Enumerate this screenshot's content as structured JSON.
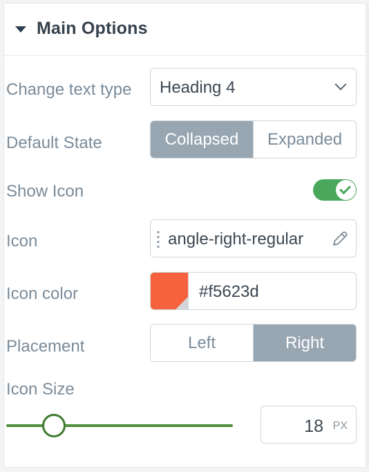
{
  "panel": {
    "title": "Main Options"
  },
  "text_type": {
    "label": "Change text type",
    "value": "Heading 4"
  },
  "default_state": {
    "label": "Default State",
    "options": [
      "Collapsed",
      "Expanded"
    ],
    "selected": "Collapsed"
  },
  "show_icon": {
    "label": "Show Icon",
    "enabled": true
  },
  "icon": {
    "label": "Icon",
    "value": "angle-right-regular"
  },
  "icon_color": {
    "label": "Icon color",
    "value": "#f5623d",
    "swatch": "#f5623d"
  },
  "placement": {
    "label": "Placement",
    "options": [
      "Left",
      "Right"
    ],
    "selected": "Right"
  },
  "icon_size": {
    "label": "Icon Size",
    "value": "18",
    "unit": "PX"
  },
  "colors": {
    "accent_green": "#4aa85c",
    "active_segment": "#98a6b2"
  }
}
